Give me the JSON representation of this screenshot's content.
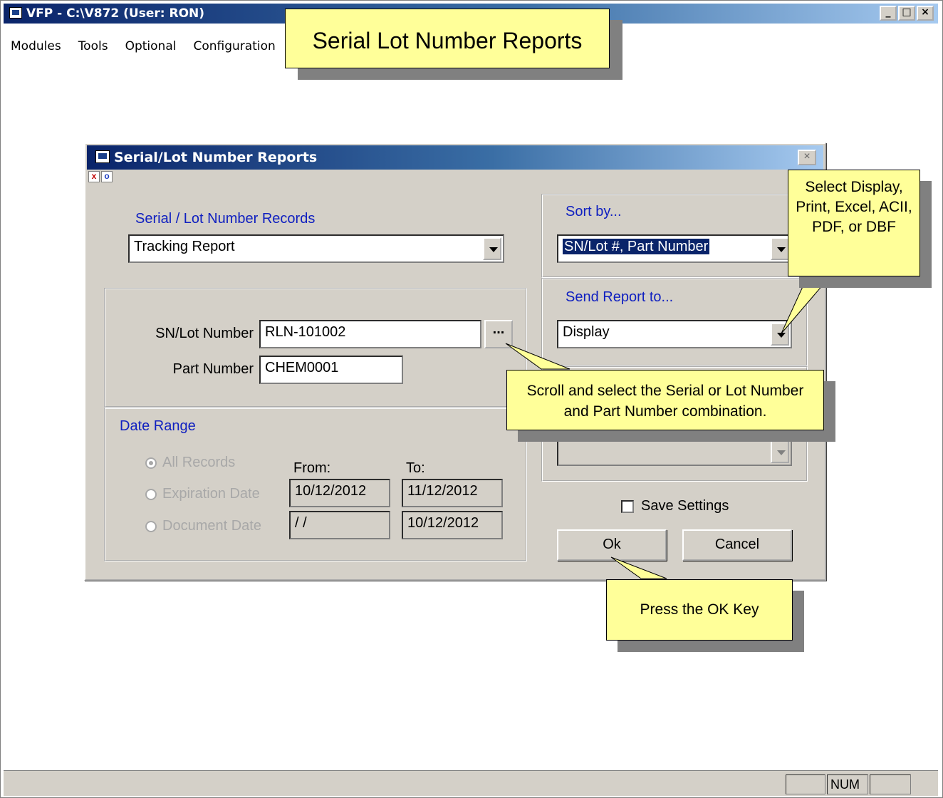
{
  "app": {
    "title": "VFP - C:\\V872  (User: RON)",
    "window_buttons": [
      "_",
      "□",
      "×"
    ],
    "menu": [
      "Modules",
      "Tools",
      "Optional",
      "Configuration"
    ],
    "status": {
      "num": "NUM"
    }
  },
  "banner": {
    "text": "Serial Lot Number Reports"
  },
  "dialog": {
    "title": "Serial/Lot Number Reports",
    "close_glyph": "×",
    "mini_icons": [
      "x",
      "o"
    ],
    "records_label": "Serial / Lot Number Records",
    "records_value": "Tracking Report",
    "sn_label": "SN/Lot Number",
    "sn_value": "RLN-101002",
    "ellipsis_label": "...",
    "part_label": "Part Number",
    "part_value": "CHEM0001",
    "date_range_label": "Date Range",
    "radio_all": "All Records",
    "radio_expiration": "Expiration Date",
    "radio_document": "Document Date",
    "from_label": "From:",
    "to_label": "To:",
    "exp_from": "10/12/2012",
    "exp_to": "11/12/2012",
    "doc_from": "/ /",
    "doc_to": "10/12/2012",
    "sort_label": "Sort by...",
    "sort_value": "SN/Lot #, Part Number",
    "send_label": "Send Report to...",
    "send_value": "Display",
    "save_settings_label": "Save Settings",
    "ok_label": "Ok",
    "cancel_label": "Cancel"
  },
  "callouts": {
    "send_tip": "Select Display, Print, Excel, ACII, PDF, or DBF",
    "scroll_tip": "Scroll and select the Serial or Lot Number and Part Number combination.",
    "ok_tip": "Press the OK Key"
  },
  "colors": {
    "titlebar_start": "#0a246a",
    "titlebar_end": "#a6caf0",
    "dialog_face": "#d4d0c8",
    "callout_fill": "#ffff99",
    "group_label": "#1020c0"
  }
}
